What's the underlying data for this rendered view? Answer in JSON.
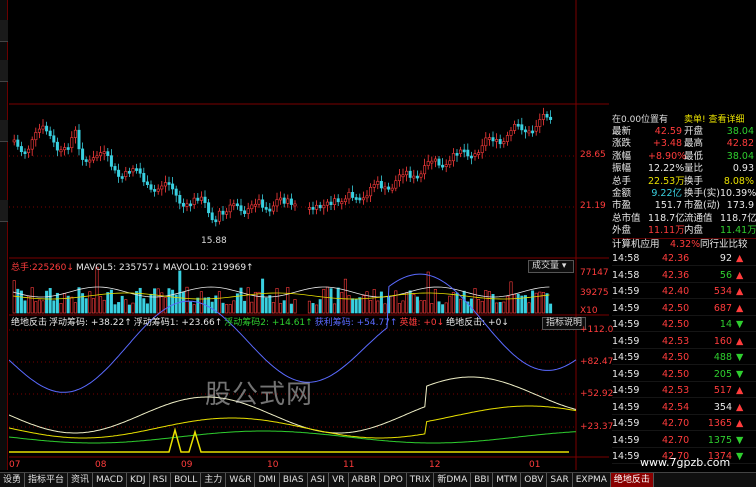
{
  "price_axis": [
    "28.65",
    "21.19"
  ],
  "low_marker": "15.88",
  "volume_panel": {
    "header": [
      {
        "text": "总手:225260↓",
        "color": "red"
      },
      {
        "text": "MAVOL5: 235757↓",
        "color": "white"
      },
      {
        "text": "MAVOL10: 219969↑",
        "color": "white"
      }
    ],
    "dropdown": "成交量",
    "axis": [
      "77147",
      "39275",
      "X10"
    ]
  },
  "indicator_panel": {
    "header": [
      {
        "text": "绝地反击",
        "color": "white"
      },
      {
        "text": "浮动筹码: +38.22↑",
        "color": "white"
      },
      {
        "text": "浮动筹码1: +23.66↑",
        "color": "white"
      },
      {
        "text": "浮动筹码2: +14.61↑",
        "color": "green"
      },
      {
        "text": "获利筹码: +54.77↑",
        "color": "blue"
      },
      {
        "text": "英雄: +0↓",
        "color": "red"
      },
      {
        "text": "绝地反击: +0↓",
        "color": "white"
      }
    ],
    "help_button": "指标说明",
    "axis": [
      "+112.0",
      "+82.47",
      "+52.92",
      "+23.37"
    ]
  },
  "time_axis": [
    "07",
    "08",
    "09",
    "10",
    "11",
    "12",
    "01"
  ],
  "watermark": "股公式网",
  "site_mark": "www.7gpzb.com",
  "quote": {
    "title_left": "在0.00位置有",
    "title_right": "卖单! 查看详细",
    "rows": [
      {
        "l": "最新",
        "v": "42.59",
        "vc": "red",
        "l2": "开盘",
        "v2": "38.04",
        "v2c": "green"
      },
      {
        "l": "涨跌",
        "v": "+3.48",
        "vc": "red",
        "l2": "最高",
        "v2": "42.82",
        "v2c": "red"
      },
      {
        "l": "涨幅",
        "v": "+8.90%",
        "vc": "red",
        "l2": "最低",
        "v2": "38.04",
        "v2c": "green"
      },
      {
        "l": "振幅",
        "v": "12.22%",
        "vc": "white",
        "l2": "量比",
        "v2": "0.93",
        "v2c": "white"
      },
      {
        "l": "总手",
        "v": "22.53万",
        "vc": "yellow",
        "l2": "换手",
        "v2": "8.08%",
        "v2c": "yellow"
      },
      {
        "l": "金额",
        "v": "9.22亿",
        "vc": "cyan",
        "l2": "换手(实)",
        "v2": "10.39%",
        "v2c": "white"
      },
      {
        "l": "市盈",
        "v": "151.7",
        "vc": "white",
        "l2": "市盈(动)",
        "v2": "173.9",
        "v2c": "white"
      },
      {
        "l": "总市值",
        "v": "118.7亿",
        "vc": "white",
        "l2": "流通值",
        "v2": "118.7亿",
        "v2c": "white"
      },
      {
        "l": "外盘",
        "v": "11.11万",
        "vc": "red",
        "l2": "内盘",
        "v2": "11.41万",
        "v2c": "green"
      }
    ],
    "sector_name": "计算机应用",
    "sector_change": "4.32%",
    "sector_link": "同行业比较"
  },
  "ticks": [
    {
      "t": "14:58",
      "p": "42.36",
      "pc": "red",
      "v": "92",
      "vc": "white",
      "dir": "up"
    },
    {
      "t": "14:58",
      "p": "42.36",
      "pc": "red",
      "v": "56",
      "vc": "green",
      "dir": "up"
    },
    {
      "t": "14:59",
      "p": "42.40",
      "pc": "red",
      "v": "534",
      "vc": "red",
      "dir": "up"
    },
    {
      "t": "14:59",
      "p": "42.50",
      "pc": "red",
      "v": "687",
      "vc": "red",
      "dir": "up"
    },
    {
      "t": "14:59",
      "p": "42.50",
      "pc": "red",
      "v": "14",
      "vc": "green",
      "dir": "down"
    },
    {
      "t": "14:59",
      "p": "42.53",
      "pc": "red",
      "v": "160",
      "vc": "red",
      "dir": "up"
    },
    {
      "t": "14:59",
      "p": "42.50",
      "pc": "red",
      "v": "488",
      "vc": "green",
      "dir": "down"
    },
    {
      "t": "14:59",
      "p": "42.50",
      "pc": "red",
      "v": "205",
      "vc": "green",
      "dir": "down"
    },
    {
      "t": "14:59",
      "p": "42.53",
      "pc": "red",
      "v": "517",
      "vc": "red",
      "dir": "up"
    },
    {
      "t": "14:59",
      "p": "42.54",
      "pc": "red",
      "v": "354",
      "vc": "white",
      "dir": "up"
    },
    {
      "t": "14:59",
      "p": "42.70",
      "pc": "red",
      "v": "1365",
      "vc": "red",
      "dir": "up"
    },
    {
      "t": "14:59",
      "p": "42.70",
      "pc": "red",
      "v": "1375",
      "vc": "green",
      "dir": "down"
    },
    {
      "t": "14:59",
      "p": "42.70",
      "pc": "red",
      "v": "1374",
      "vc": "red",
      "dir": "down"
    }
  ],
  "tabs": [
    "设勇",
    "指标平台",
    "资讯",
    "MACD",
    "KDJ",
    "RSI",
    "BOLL",
    "主力",
    "W&R",
    "DMI",
    "BIAS",
    "ASI",
    "VR",
    "ARBR",
    "DPO",
    "TRIX",
    "新DMA",
    "BBI",
    "MTM",
    "OBV",
    "SAR",
    "EXPMA",
    "绝地反击"
  ],
  "active_tab": "绝地反击",
  "colors": {
    "up": "#ff3c3c",
    "down": "#39d0e0",
    "bg": "#000000",
    "grid": "#7a0000"
  }
}
